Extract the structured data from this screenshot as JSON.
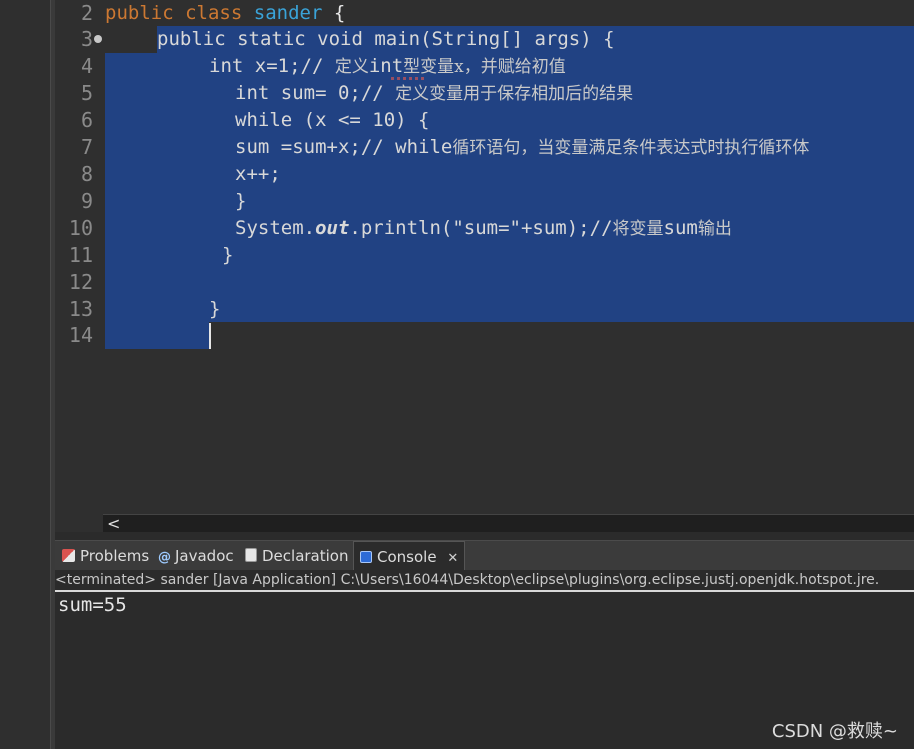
{
  "editor": {
    "line_numbers": [
      "2",
      "3",
      "4",
      "5",
      "6",
      "7",
      "8",
      "9",
      "10",
      "11",
      "12",
      "13",
      "14"
    ],
    "line2": {
      "kw1": "public",
      "kw2": "class",
      "cls": "sander",
      "rest": " {"
    },
    "line3": "public static void main(String[] args) {",
    "line4": {
      "code": "int x=1;// ",
      "cmt_a": "定义",
      "cmt_b": "int",
      "cmt_c": "型变量x，并赋给初值"
    },
    "line5": {
      "code": "int sum= 0;// ",
      "cmt": "定义变量用于保存相加后的结果"
    },
    "line6": "while (x <= 10) {",
    "line7": {
      "code": "sum =sum+x;// while",
      "cmt": "循环语句，当变量满足条件表达式时执行循环体"
    },
    "line8": "x++;",
    "line9": "}",
    "line10": {
      "a": "System.",
      "b": "out",
      "c": ".println(\"sum=\"+sum);//",
      "cmt": "将变量",
      "d": "sum",
      "cmt2": "输出"
    },
    "line11": "}",
    "line13": "}"
  },
  "panel": {
    "tabs": [
      {
        "label": "Problems",
        "icon": "problems-icon"
      },
      {
        "label": "Javadoc",
        "icon": "javadoc-icon"
      },
      {
        "label": "Declaration",
        "icon": "declaration-icon"
      },
      {
        "label": "Console",
        "icon": "console-icon",
        "close": "✕"
      }
    ],
    "console_header": "<terminated> sander [Java Application] C:\\Users\\16044\\Desktop\\eclipse\\plugins\\org.eclipse.justj.openjdk.hotspot.jre.",
    "console_output": "sum=55"
  },
  "scroll": {
    "left_arrow": "<"
  },
  "watermark": "CSDN @救赎~",
  "colors": {
    "selection": "#214283",
    "keyword": "#cc7832",
    "class_name": "#3aa3d8",
    "background": "#2f2f2f"
  }
}
